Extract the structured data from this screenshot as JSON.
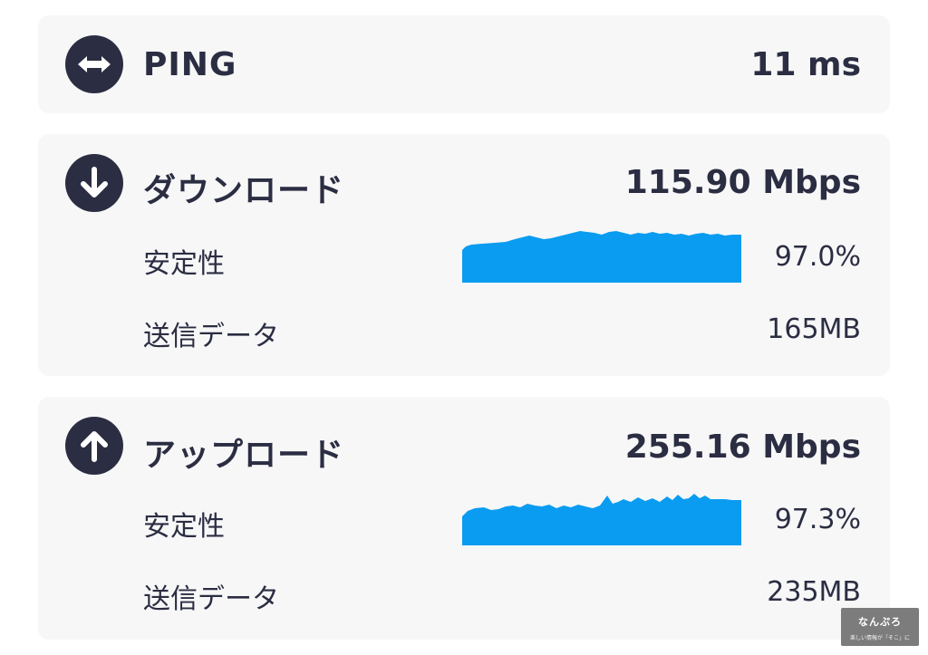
{
  "ping": {
    "title": "PING",
    "value": "11 ms",
    "icon": "double-arrow-horizontal-icon"
  },
  "download": {
    "title": "ダウンロード",
    "value": "115.90 Mbps",
    "icon": "arrow-down-circle-icon",
    "stability_label": "安定性",
    "stability_value": "97.0%",
    "stability_fraction": 0.97,
    "data_label": "送信データ",
    "data_value": "165MB"
  },
  "upload": {
    "title": "アップロード",
    "value": "255.16 Mbps",
    "icon": "arrow-up-circle-icon",
    "stability_label": "安定性",
    "stability_value": "97.3%",
    "stability_fraction": 0.973,
    "data_label": "送信データ",
    "data_value": "235MB"
  },
  "colors": {
    "accent": "#0a9cf0",
    "dark": "#2b2d42",
    "card": "#f7f7f8"
  },
  "watermark": {
    "title": "なんぷろ",
    "subtitle": "楽しい情報が「そこ」に"
  }
}
